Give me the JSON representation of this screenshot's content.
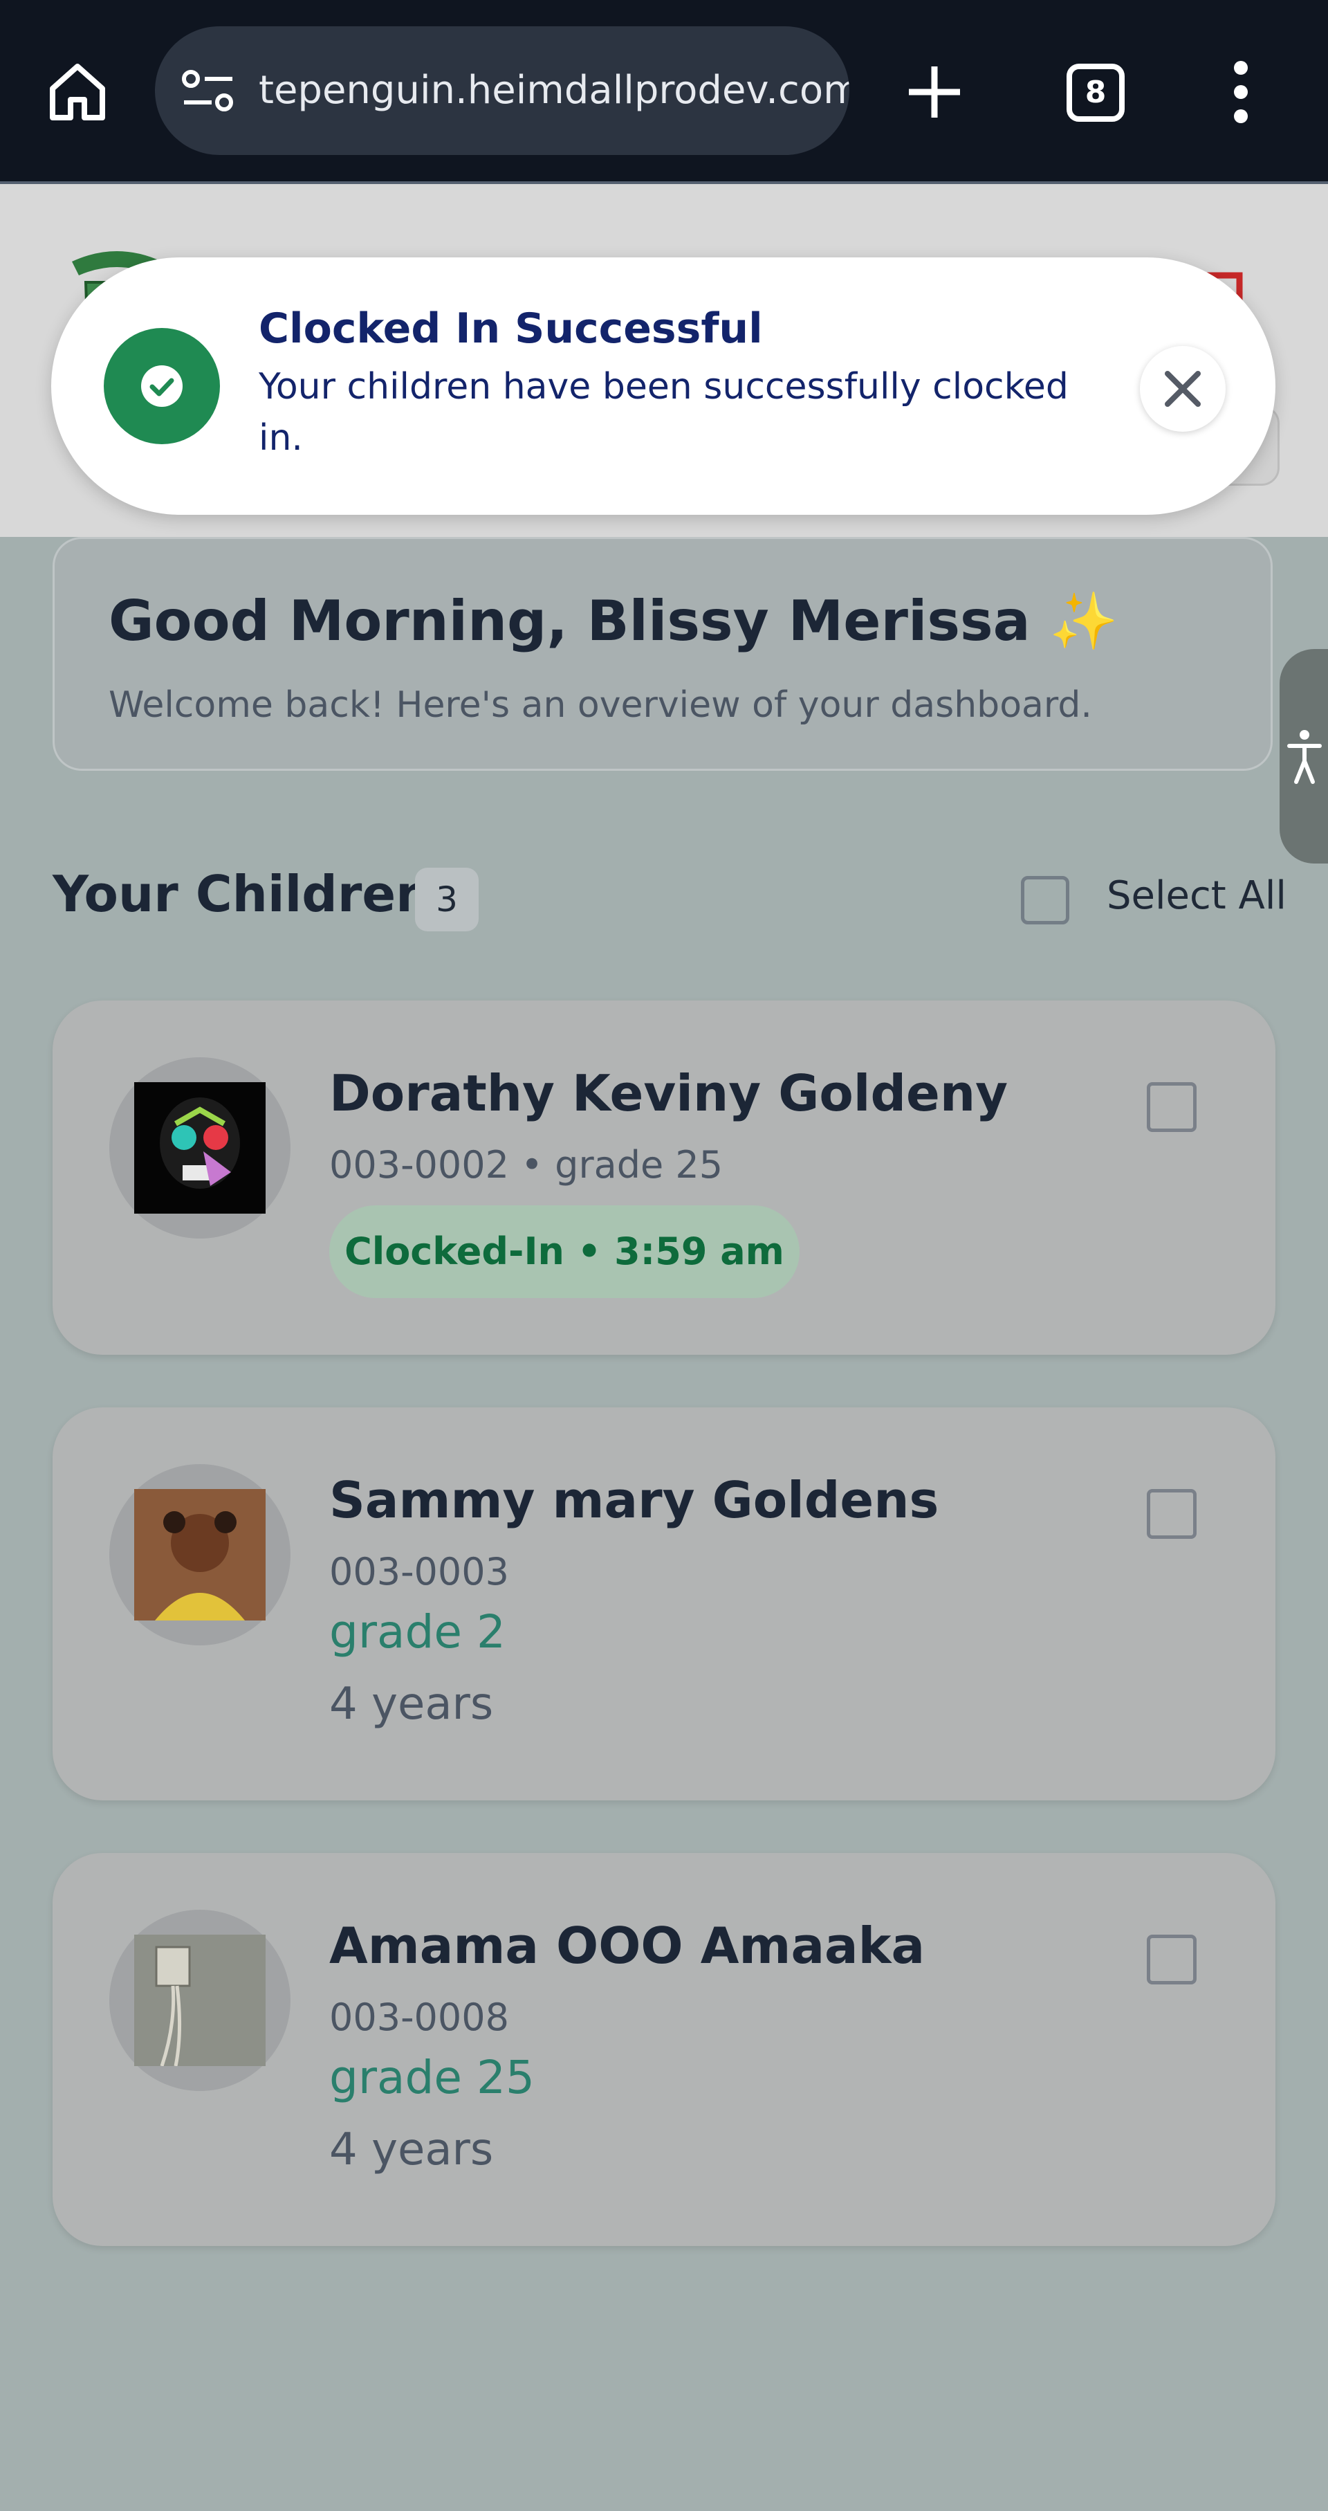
{
  "browser": {
    "url": "tepenguin.heimdallprodev.com",
    "tab_count": "8",
    "icons": [
      "home-icon",
      "site-settings-icon",
      "new-tab-icon",
      "tabs-icon",
      "more-menu-icon"
    ]
  },
  "toast": {
    "title": "Clocked In Successful",
    "message": "Your children have been successfully clocked in.",
    "icon": "check-circle-icon",
    "close_icon": "close-icon",
    "accent_color": "#1f8a52"
  },
  "greeting": {
    "title": "Good Morning, Blissy Merissa ✨",
    "subtitle": "Welcome back! Here's an overview of your dashboard."
  },
  "children_section": {
    "title": "Your Children",
    "count": "3",
    "select_all_label": "Select All"
  },
  "children": [
    {
      "name": "Dorathy Keviny Goldeny",
      "meta": "003-0002 • grade 25",
      "status": "Clocked-In • 3:59 am",
      "status_color": "#0e6b3c"
    },
    {
      "name": "Sammy mary Goldens",
      "meta": "003-0003",
      "grade": "grade 2",
      "age": "4 years"
    },
    {
      "name": "Amama OOO Amaaka",
      "meta": "003-0008",
      "grade": "grade 25",
      "age": "4 years"
    }
  ]
}
